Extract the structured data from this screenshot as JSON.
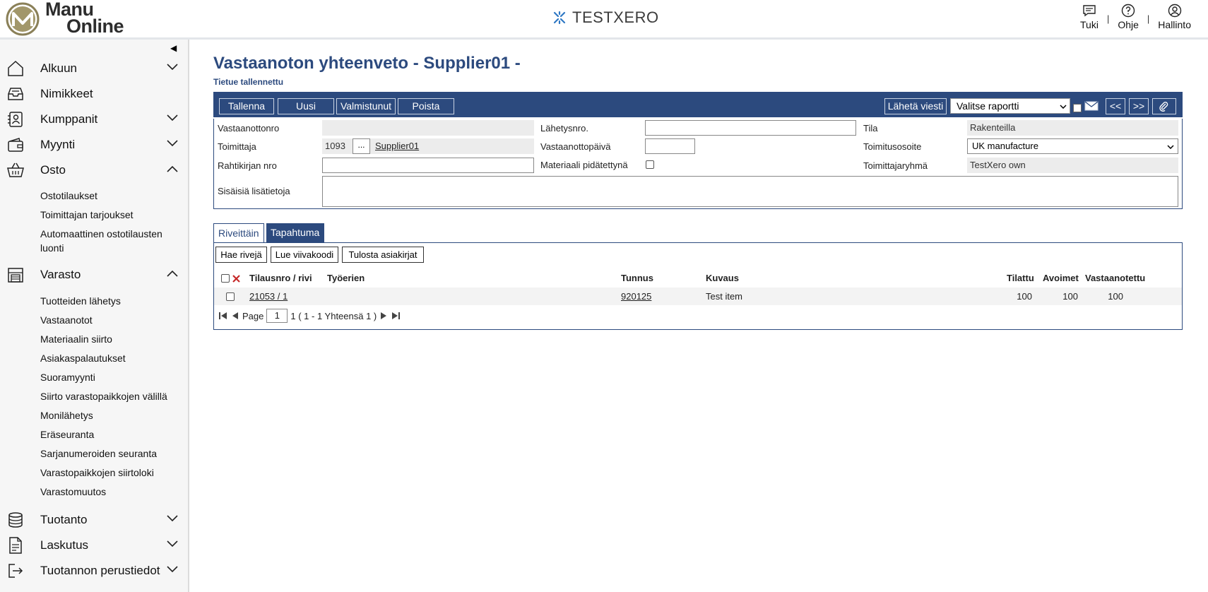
{
  "header": {
    "logo_line1": "Manu",
    "logo_line2": "Online",
    "brand": "TESTXERO",
    "links": [
      {
        "label": "Tuki",
        "icon": "chat-icon"
      },
      {
        "label": "Ohje",
        "icon": "help-icon"
      },
      {
        "label": "Hallinto",
        "icon": "user-icon"
      }
    ],
    "separator": "|"
  },
  "sidebar": {
    "collapse_glyph": "◀",
    "main_items": [
      {
        "label": "Alkuun",
        "icon": "home-icon"
      },
      {
        "label": "Nimikkeet",
        "icon": "inbox-icon"
      },
      {
        "label": "Kumppanit",
        "icon": "contacts-icon"
      },
      {
        "label": "Myynti",
        "icon": "wallet-icon"
      },
      {
        "label": "Osto",
        "icon": "basket-icon"
      },
      {
        "label": "Varasto",
        "icon": "warehouse-icon"
      },
      {
        "label": "Tuotanto",
        "icon": "database-icon"
      },
      {
        "label": "Laskutus",
        "icon": "document-icon"
      },
      {
        "label": "Tuotannon perustiedot",
        "icon": "exit-icon"
      }
    ],
    "osto_sub": [
      "Ostotilaukset",
      "Toimittajan tarjoukset",
      "Automaattinen ostotilausten luonti"
    ],
    "varasto_sub": [
      "Tuotteiden lähetys",
      "Vastaanotot",
      "Materiaalin siirto",
      "Asiakaspalautukset",
      "Suoramyynti",
      "Siirto varastopaikkojen välillä",
      "Monilähetys",
      "Eräseuranta",
      "Sarjanumeroiden seuranta",
      "Varastopaikkojen siirtoloki",
      "Varastomuutos"
    ]
  },
  "page": {
    "title": "Vastaanoton yhteenveto - Supplier01 -",
    "subtitle": "Tietue tallennettu"
  },
  "toolbar": {
    "save": "Tallenna",
    "new": "Uusi",
    "ready": "Valmistunut",
    "delete": "Poista",
    "send_message": "Lähetä viesti",
    "report_select": "Valitse raportti",
    "prev": "<<",
    "next": ">>"
  },
  "form": {
    "receipt_no_label": "Vastaanottonro",
    "receipt_no_value": "",
    "shipment_no_label": "Lähetysnro.",
    "shipment_no_value": "",
    "status_label": "Tila",
    "status_value": "Rakenteilla",
    "supplier_label": "Toimittaja",
    "supplier_code": "1093",
    "supplier_btn": "...",
    "supplier_name": "Supplier01",
    "receipt_date_label": "Vastaanottopäivä",
    "receipt_date_value": "",
    "delivery_address_label": "Toimitusosoite",
    "delivery_address_value": "UK manufacture",
    "waybill_label": "Rahtikirjan nro",
    "waybill_value": "",
    "material_held_label": "Materiaali pidätettynä",
    "supplier_group_label": "Toimittajaryhmä",
    "supplier_group_value": "TestXero own",
    "internal_info_label": "Sisäisiä lisätietoja"
  },
  "tabs": {
    "rows": "Riveittäin",
    "event": "Tapahtuma"
  },
  "panel": {
    "fetch_rows": "Hae rivejä",
    "read_barcode": "Lue viivakoodi",
    "print_docs": "Tulosta asiakirjat",
    "columns": {
      "order_row": "Tilausnro / rivi",
      "batch": "Työerien",
      "code": "Tunnus",
      "description": "Kuvaus",
      "ordered": "Tilattu",
      "open": "Avoimet",
      "received": "Vastaanotettu"
    },
    "rows": [
      {
        "order_row": "21053 / 1",
        "batch": "",
        "code": "920125",
        "description": "Test item",
        "ordered": "100",
        "open": "100",
        "received": "100"
      }
    ],
    "pager": {
      "page_label": "Page",
      "page_value": "1",
      "summary": "1 ( 1 - 1 Yhteensä 1 )"
    }
  }
}
